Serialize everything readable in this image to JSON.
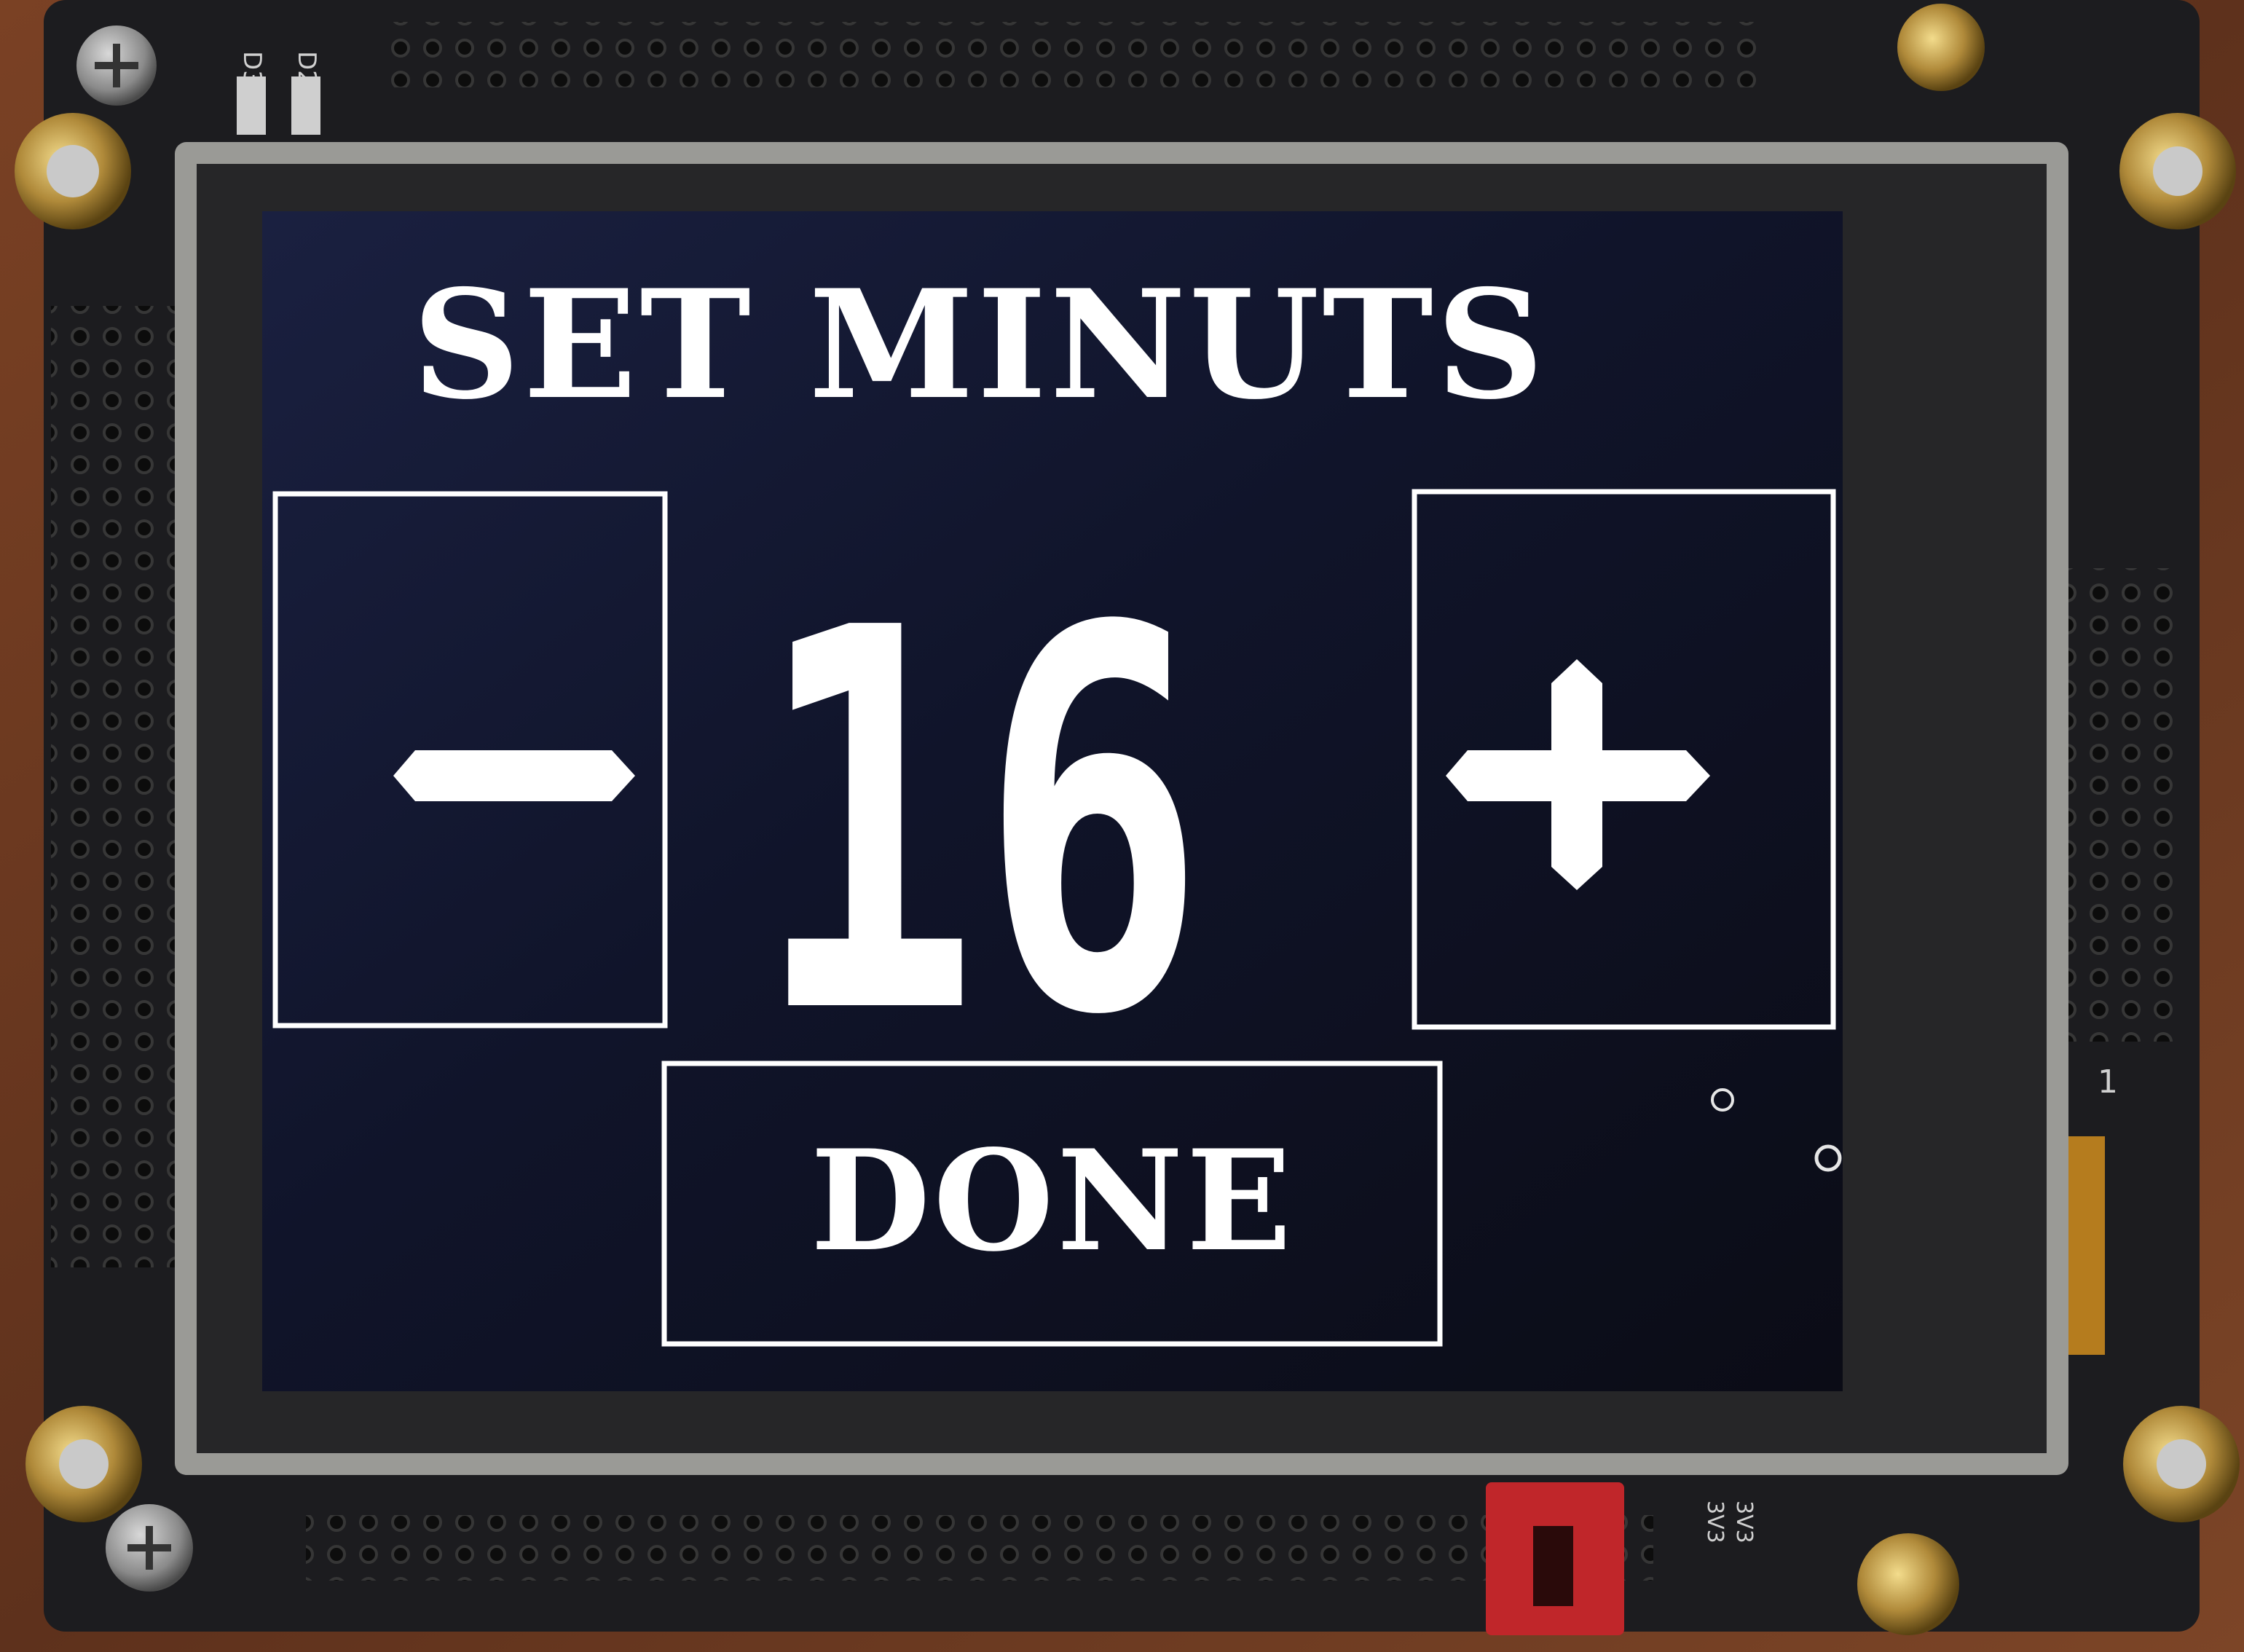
{
  "screen": {
    "title": "SET MINUTS",
    "value": "16",
    "decrement_label": "-",
    "increment_label": "+",
    "done_label": "DONE"
  },
  "board": {
    "silkscreen_top": [
      "D3",
      "D2"
    ],
    "silkscreen_side": "1",
    "silkscreen_bottom": [
      "3V3",
      "3V3"
    ]
  },
  "colors": {
    "screen_bg": "#0f1226",
    "ui_white": "#ffffff",
    "pcb": "#1b1b1d",
    "wood": "#6e3b22",
    "jumper": "#c0262a",
    "brass": "#b08a3a"
  }
}
